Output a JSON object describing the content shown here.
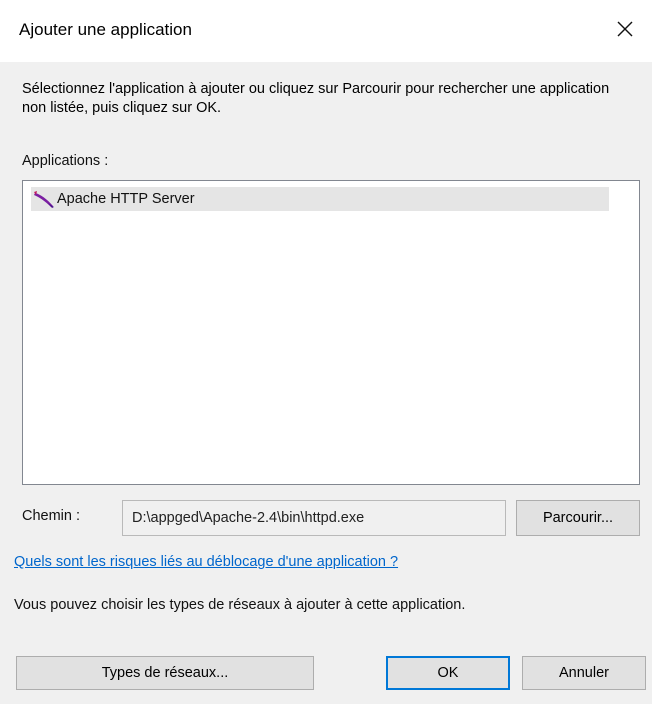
{
  "dialog": {
    "title": "Ajouter une application",
    "close_icon": "close-icon"
  },
  "instructions": "Sélectionnez l'application à ajouter ou cliquez sur Parcourir pour rechercher une application non listée, puis cliquez sur OK.",
  "applications": {
    "label": "Applications :",
    "items": [
      {
        "name": "Apache HTTP Server",
        "icon": "apache-feather-icon",
        "selected": true
      }
    ]
  },
  "path": {
    "label": "Chemin :",
    "value": "D:\\appged\\Apache-2.4\\bin\\httpd.exe"
  },
  "buttons": {
    "browse": "Parcourir...",
    "network_types": "Types de réseaux...",
    "ok": "OK",
    "cancel": "Annuler"
  },
  "risk_link": "Quels sont les risques liés au déblocage d'une application ?",
  "network_note": "Vous pouvez choisir les types de réseaux à ajouter à cette application.",
  "colors": {
    "accent": "#0078d7",
    "link": "#0066cc",
    "feather": "#7b1fa2"
  }
}
